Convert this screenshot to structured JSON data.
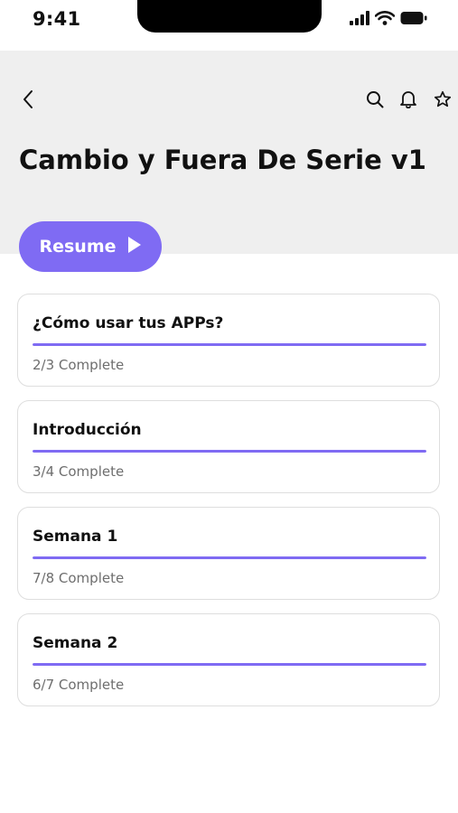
{
  "status_bar": {
    "time": "9:41",
    "icons": [
      "signal-icon",
      "wifi-icon",
      "battery-icon"
    ]
  },
  "header": {
    "back_icon": "chevron-left-icon",
    "actions": [
      "search-icon",
      "bell-icon",
      "star-icon"
    ],
    "title": "Cambio y Fuera De Serie v1"
  },
  "resume_button": {
    "label": "Resume",
    "icon": "play-icon"
  },
  "colors": {
    "accent": "#7f6bf3",
    "header_bg": "#efefef",
    "card_border": "#dedede"
  },
  "modules": [
    {
      "title": "¿Cómo usar tus APPs?",
      "status": "2/3 Complete",
      "progress": 1.0
    },
    {
      "title": "Introducción",
      "status": "3/4 Complete",
      "progress": 1.0
    },
    {
      "title": "Semana 1",
      "status": "7/8 Complete",
      "progress": 1.0
    },
    {
      "title": "Semana 2",
      "status": "6/7 Complete",
      "progress": 1.0
    }
  ]
}
